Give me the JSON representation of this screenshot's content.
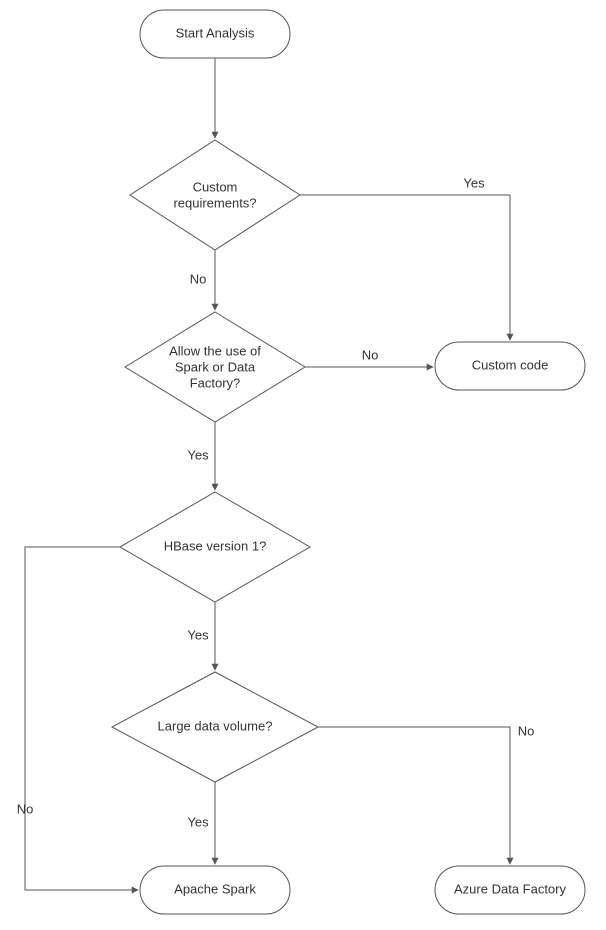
{
  "chart_data": {
    "type": "flowchart",
    "nodes": [
      {
        "id": "start",
        "shape": "terminator",
        "label": "Start Analysis"
      },
      {
        "id": "d1",
        "shape": "decision",
        "label": "Custom requirements?"
      },
      {
        "id": "d2",
        "shape": "decision",
        "label": "Allow the use of Spark or Data Factory?"
      },
      {
        "id": "d3",
        "shape": "decision",
        "label": "HBase version 1?"
      },
      {
        "id": "d4",
        "shape": "decision",
        "label": "Large data volume?"
      },
      {
        "id": "custom",
        "shape": "terminator",
        "label": "Custom code"
      },
      {
        "id": "spark",
        "shape": "terminator",
        "label": "Apache Spark"
      },
      {
        "id": "adf",
        "shape": "terminator",
        "label": "Azure Data Factory"
      }
    ],
    "edges": [
      {
        "from": "start",
        "to": "d1"
      },
      {
        "from": "d1",
        "to": "custom",
        "label": "Yes"
      },
      {
        "from": "d1",
        "to": "d2",
        "label": "No"
      },
      {
        "from": "d2",
        "to": "custom",
        "label": "No"
      },
      {
        "from": "d2",
        "to": "d3",
        "label": "Yes"
      },
      {
        "from": "d3",
        "to": "spark",
        "label": "No"
      },
      {
        "from": "d3",
        "to": "d4",
        "label": "Yes"
      },
      {
        "from": "d4",
        "to": "adf",
        "label": "No"
      },
      {
        "from": "d4",
        "to": "spark",
        "label": "Yes"
      }
    ]
  },
  "nodes": {
    "start": "Start Analysis",
    "d1_line1": "Custom",
    "d1_line2": "requirements?",
    "d2_line1": "Allow the use of",
    "d2_line2": "Spark or Data",
    "d2_line3": "Factory?",
    "d3": "HBase version 1?",
    "d4": "Large data volume?",
    "custom": "Custom code",
    "spark": "Apache Spark",
    "adf": "Azure Data Factory"
  },
  "edges": {
    "yes": "Yes",
    "no": "No"
  }
}
